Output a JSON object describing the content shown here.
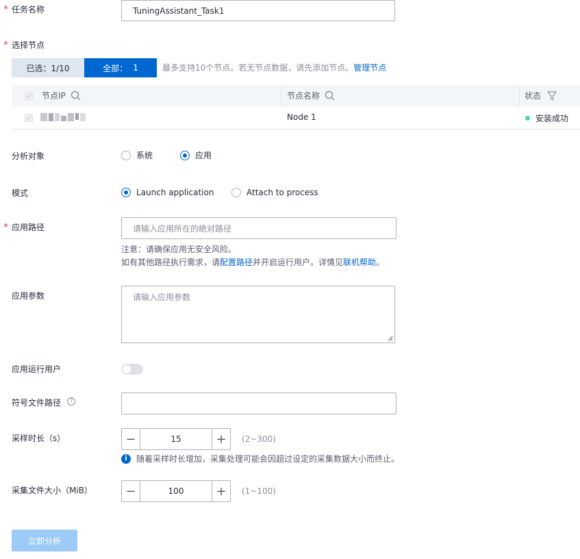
{
  "task_name": {
    "label": "任务名称",
    "value": "TuningAssistant_Task1"
  },
  "node_select": {
    "label": "选择节点",
    "selected_tab": "已选：1/10",
    "all_tab": "全部：",
    "all_count": "1",
    "hint": "最多支持10个节点。若无节点数据，请先添加节点。",
    "manage_link": "管理节点"
  },
  "table": {
    "headers": {
      "ip": "节点IP",
      "name": "节点名称",
      "status": "状态"
    },
    "rows": [
      {
        "ip": "",
        "name": "Node 1",
        "status": "安装成功",
        "status_color": "#50d4ab"
      }
    ]
  },
  "analysis_target": {
    "label": "分析对象",
    "options": [
      "系统",
      "应用"
    ],
    "selected": "应用"
  },
  "mode": {
    "label": "模式",
    "options": [
      "Launch application",
      "Attach to process"
    ],
    "selected": "Launch application"
  },
  "app_path": {
    "label": "应用路径",
    "placeholder": "请输入应用所在的绝对路径",
    "note1": "注意：请确保应用无安全风险。",
    "note2_pre": "如有其他路径执行需求，请",
    "note2_link1": "配置路径",
    "note2_mid": "并开启运行用户。详情见",
    "note2_link2": "联机帮助",
    "note2_end": "。"
  },
  "app_params": {
    "label": "应用参数",
    "placeholder": "请输入应用参数"
  },
  "run_user": {
    "label": "应用运行用户",
    "enabled": false
  },
  "symbol_path": {
    "label": "符号文件路径",
    "value": ""
  },
  "sample_duration": {
    "label": "采样时长（s）",
    "value": "15",
    "range": "(2~300)",
    "info": "随着采样时长增加，采集处理可能会因超过设定的采集数据大小而终止。"
  },
  "file_size": {
    "label": "采集文件大小（MiB）",
    "value": "100",
    "range": "(1~100)"
  },
  "submit": {
    "label": "立即分析"
  },
  "colors": {
    "primary": "#0067d1",
    "success": "#50d4ab",
    "required": "#e54545",
    "disabled_btn": "#9ccbf7"
  }
}
